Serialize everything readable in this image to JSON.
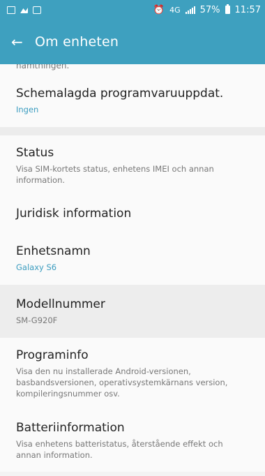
{
  "status_bar": {
    "left_icons": [
      "image-icon",
      "gallery-icon",
      "chat-icon"
    ],
    "right_text": {
      "network": "4G",
      "battery": "57%",
      "time": "11:57"
    }
  },
  "app_bar": {
    "title": "Om enheten"
  },
  "cut_off_text": "hämtningen.",
  "items": [
    {
      "title": "Schemalagda programvaruuppdat.",
      "subtitle": "Ingen"
    },
    {
      "title": "Status",
      "subtitle": "Visa SIM-kortets status, enhetens IMEI och annan information."
    },
    {
      "title": "Juridisk information",
      "subtitle": ""
    },
    {
      "title": "Enhetsnamn",
      "subtitle": "Galaxy S6"
    },
    {
      "title": "Modellnummer",
      "subtitle": "SM-G920F"
    },
    {
      "title": "Programinfo",
      "subtitle": "Visa den nu installerade Android-versionen, basbandsversionen, operativsystemkärnans version, kompileringsnummer osv."
    },
    {
      "title": "Batteriinformation",
      "subtitle": "Visa enhetens batteristatus, återstående effekt och annan information."
    }
  ],
  "colors": {
    "accent": "#3ea0bf",
    "subtitle_accent": "#3b9cbf"
  }
}
